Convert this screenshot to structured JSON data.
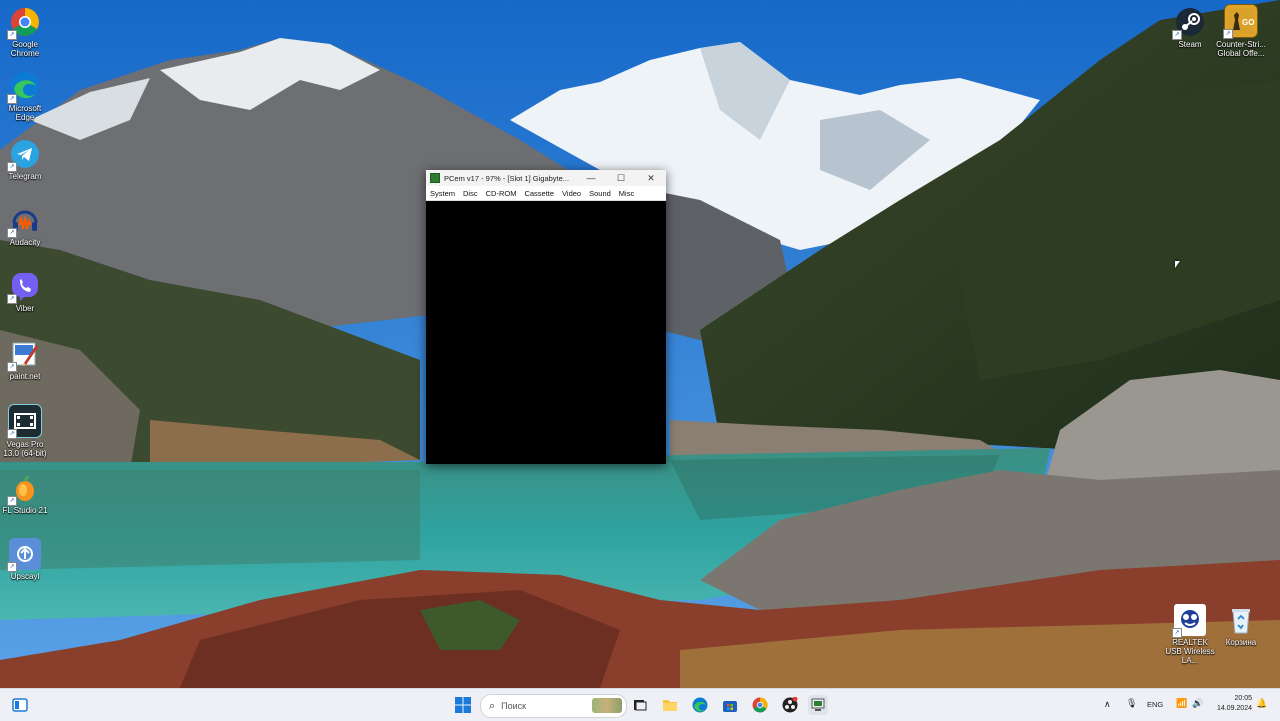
{
  "desktop_left": [
    {
      "label": "Google Chrome"
    },
    {
      "label": "Microsoft Edge"
    },
    {
      "label": "Telegram"
    },
    {
      "label": "Audacity"
    },
    {
      "label": "Viber"
    },
    {
      "label": "paint.net"
    },
    {
      "label": "Vegas Pro 13.0 (64-bit)"
    },
    {
      "label": "FL Studio 21"
    },
    {
      "label": "Upscayl"
    }
  ],
  "desktop_right_top": [
    {
      "label": "Steam"
    },
    {
      "label": "Counter-Stri... Global Offe..."
    }
  ],
  "desktop_right_bottom": [
    {
      "label": "REALTEK USB Wireless LA..."
    },
    {
      "label": "Корзина"
    }
  ],
  "pcem_window": {
    "title": "PCem v17 - 97% - [Slot 1] Gigabyte...",
    "menu": [
      "System",
      "Disc",
      "CD-ROM",
      "Cassette",
      "Video",
      "Sound",
      "Misc"
    ],
    "minimize": "—",
    "maximize": "☐",
    "close": "✕"
  },
  "taskbar": {
    "search_placeholder": "Поиск",
    "language": "ENG",
    "time": "20:05",
    "date": "14.09.2024"
  },
  "colors": {
    "sky": "#1f73d1",
    "lake": "#2f9c9a",
    "taskbar": "#eef0f5"
  }
}
